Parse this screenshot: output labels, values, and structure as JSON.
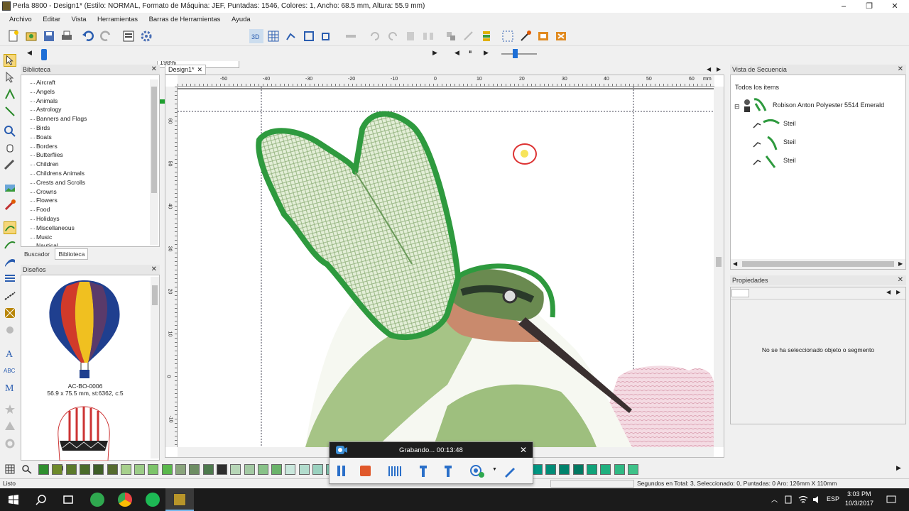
{
  "window": {
    "title": "Perla 8800 - Design1* (Estilo: NORMAL, Formato de Máquina: JEF, Puntadas: 1546, Colores: 1, Ancho: 68.5 mm, Altura: 55.9 mm)",
    "minimize": "–",
    "maximize": "❐",
    "close": "✕"
  },
  "menu": [
    "Archivo",
    "Editar",
    "Vista",
    "Herramientas",
    "Barras de Herramientas",
    "Ayuda"
  ],
  "toolbar": {
    "zoom": "198%"
  },
  "library": {
    "header": "Biblioteca",
    "close": "✕",
    "items": [
      "Aircraft",
      "Angels",
      "Animals",
      "Astrology",
      "Banners and Flags",
      "Birds",
      "Boats",
      "Borders",
      "Butterflies",
      "Children",
      "Childrens Animals",
      "Crests and Scrolls",
      "Crowns",
      "Flowers",
      "Food",
      "Holidays",
      "Miscellaneous",
      "Music",
      "Nautical"
    ],
    "tabs": [
      "Buscador",
      "Biblioteca"
    ]
  },
  "designs": {
    "header": "Diseños",
    "close": "✕",
    "item1_name": "AC-BO-0006",
    "item1_info": "56.9 x 75.5 mm, st:6362, c:5"
  },
  "canvas": {
    "tab": "Design1*",
    "tab_close": "✕",
    "unit": "mm",
    "hticks": [
      "-50",
      "-40",
      "-30",
      "-20",
      "-10",
      "0",
      "10",
      "20",
      "30",
      "40",
      "50",
      "60"
    ],
    "vticks": [
      "60",
      "50",
      "40",
      "30",
      "20",
      "10",
      "0",
      "0",
      "-10"
    ]
  },
  "sequence": {
    "header": "Vista de Secuencia",
    "close": "✕",
    "root": "Todos los items",
    "thread": "Robison Anton Polyester 5514 Emerald",
    "items": [
      "Steil",
      "Steil",
      "Steil"
    ]
  },
  "properties": {
    "header": "Propiedades",
    "close": "✕",
    "empty": "No se ha seleccionado objeto o segmento"
  },
  "palette": {
    "colors": [
      "#2f8f2f",
      "#6d8a2a",
      "#5c7a2c",
      "#4a6b2a",
      "#3f5e28",
      "#556b2f",
      "#a7d08c",
      "#9ccc88",
      "#7cc46a",
      "#5ab84c",
      "#8aa57d",
      "#6e8e64",
      "#4d7a4d",
      "#2e2e2e",
      "#b7d6b7",
      "#a3c9a3",
      "#88c288",
      "#6ab36a",
      "#c9e7dc",
      "#b2dccd",
      "#9ad1bf",
      "#80c7b0",
      "#66bca2",
      "#4db294",
      "#33a786",
      "#1a9d78",
      "#00926a",
      "#00a887",
      "#19b097",
      "#33b8a6",
      "#4dc0b5",
      "#66c8c4",
      "#7fd0d3",
      "#1fb3a3",
      "#0fa898",
      "#00a08d",
      "#009682",
      "#008c77",
      "#00826c",
      "#007861",
      "#10a37a",
      "#20b07f",
      "#30b984",
      "#3fc289"
    ]
  },
  "status": {
    "left": "Listo",
    "right": "Segundos en Total: 3, Seleccionado: 0, Puntadas: 0  Aro: 126mm X 110mm"
  },
  "recorder": {
    "title": "Grabando... 00:13:48",
    "close": "✕"
  },
  "taskbar": {
    "time": "3:03 PM",
    "date": "10/3/2017",
    "lang": "ESP"
  }
}
